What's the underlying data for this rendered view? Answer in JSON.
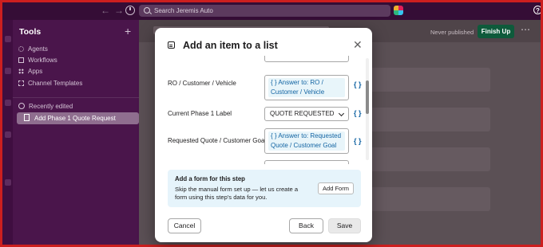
{
  "top_bar": {
    "search_placeholder": "Search Jeremis Auto"
  },
  "sidebar": {
    "title": "Tools",
    "items": [
      {
        "label": "Agents",
        "icon": "agents-icon"
      },
      {
        "label": "Workflows",
        "icon": "workflows-icon"
      },
      {
        "label": "Apps",
        "icon": "apps-icon"
      },
      {
        "label": "Channel Templates",
        "icon": "channel-templates-icon"
      }
    ],
    "recently_edited_label": "Recently edited",
    "active_item_label": "Add Phase 1 Quote Request"
  },
  "workflow_header": {
    "status": "Never published",
    "finish_button": "Finish Up"
  },
  "modal": {
    "title": "Add an item to a list",
    "fields": [
      {
        "label": "RO / Customer / Vehicle",
        "type": "token",
        "token": "{ } Answer to: RO / Customer / Vehicle"
      },
      {
        "label": "Current Phase 1 Label",
        "type": "select",
        "value": "QUOTE REQUESTED"
      },
      {
        "label": "Requested Quote / Customer Goal",
        "type": "token",
        "token": "{ } Answer to: Requested Quote / Customer Goal"
      }
    ],
    "variable_button_label": "{ }",
    "form_card": {
      "title": "Add a form for this step",
      "description": "Skip the manual form set up — let us create a form using this step's data for you.",
      "button": "Add Form"
    },
    "buttons": {
      "cancel": "Cancel",
      "back": "Back",
      "save": "Save"
    }
  },
  "colors": {
    "sidebar_bg": "#4a154b",
    "finish_button": "#0e5a3b",
    "token_text": "#1264a3",
    "form_card_bg": "#e6f4fb"
  }
}
